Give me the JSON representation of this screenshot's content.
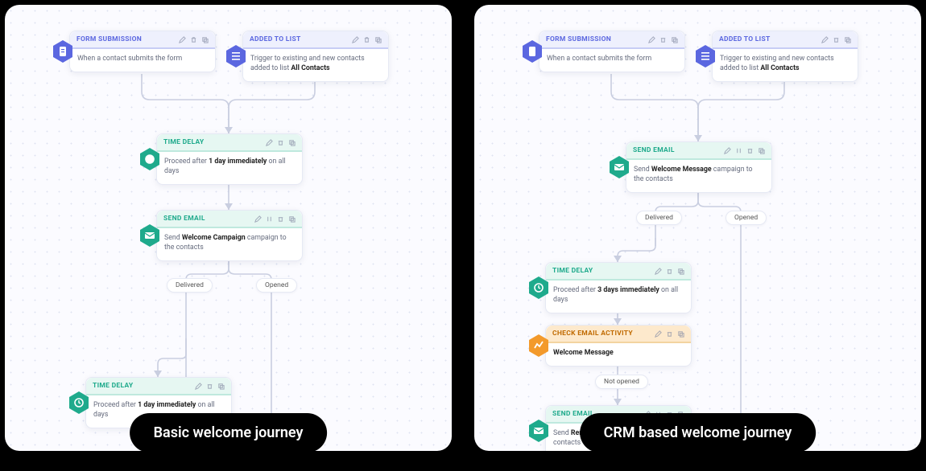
{
  "left": {
    "caption": "Basic welcome journey",
    "triggers": {
      "form": {
        "title": "FORM SUBMISSION",
        "body": "When a contact submits the form"
      },
      "list": {
        "title": "ADDED TO LIST",
        "body_pre": "Trigger to existing and new contacts added to list ",
        "body_bold": "All Contacts"
      }
    },
    "delay1": {
      "title": "TIME DELAY",
      "pre": "Proceed after ",
      "bold": "1 day immediately",
      "post": " on all days"
    },
    "email": {
      "title": "SEND EMAIL",
      "pre": "Send ",
      "bold": "Welcome Campaign",
      "post": " campaign to the contacts"
    },
    "branch": {
      "delivered": "Delivered",
      "opened": "Opened"
    },
    "delay2": {
      "title": "TIME DELAY",
      "pre": "Proceed after ",
      "bold": "1 day immediately",
      "post": " on all days"
    }
  },
  "right": {
    "caption": "CRM based welcome journey",
    "triggers": {
      "form": {
        "title": "FORM SUBMISSION",
        "body": "When a contact submits the form"
      },
      "list": {
        "title": "ADDED TO LIST",
        "body_pre": "Trigger to existing and new contacts added to list ",
        "body_bold": "All Contacts"
      }
    },
    "email1": {
      "title": "SEND EMAIL",
      "pre": "Send ",
      "bold": "Welcome Message",
      "post": " campaign to the contacts"
    },
    "branch1": {
      "delivered": "Delivered",
      "opened": "Opened"
    },
    "delay": {
      "title": "TIME DELAY",
      "pre": "Proceed after ",
      "bold": "3 days immediately",
      "post": " on all days"
    },
    "check": {
      "title": "CHECK EMAIL ACTIVITY",
      "body": "Welcome Message"
    },
    "branch2": {
      "notopened": "Not opened"
    },
    "email2": {
      "title": "SEND EMAIL",
      "pre": "Send ",
      "bold": "Reminder 1",
      "post": " campaign to the contacts"
    }
  }
}
